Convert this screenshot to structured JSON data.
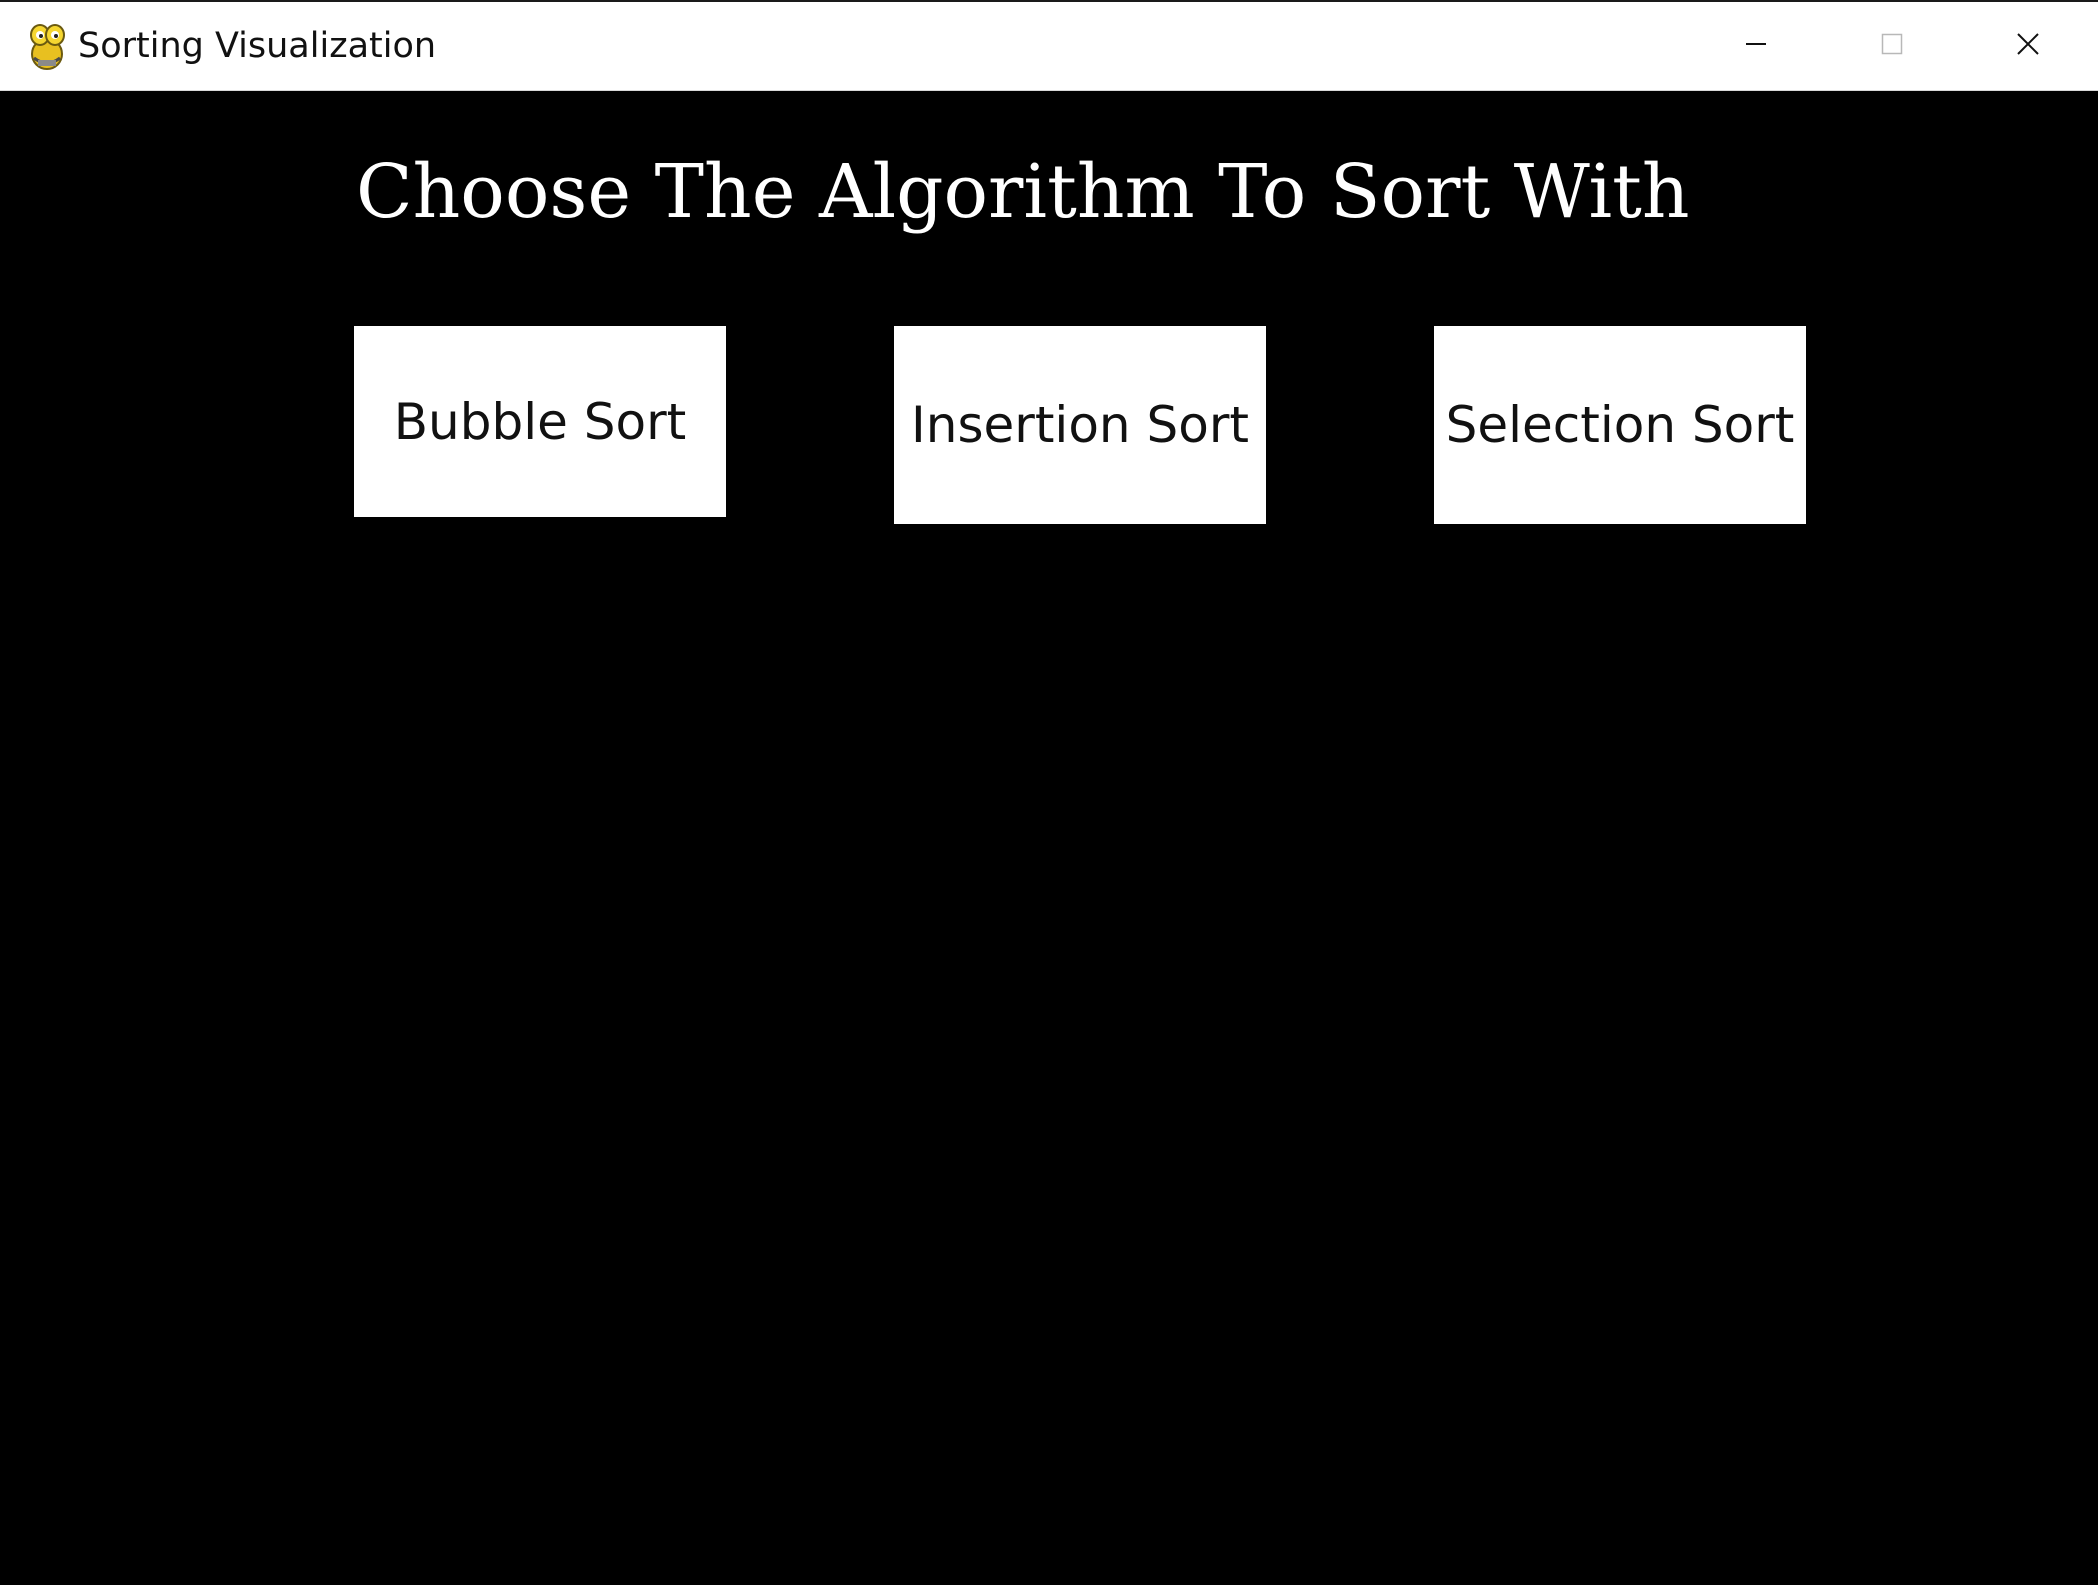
{
  "window": {
    "title": "Sorting Visualization",
    "icon": "pygame-snake-icon"
  },
  "controls": {
    "minimize_icon": "minimize-icon",
    "maximize_icon": "maximize-icon",
    "close_icon": "close-icon"
  },
  "main": {
    "heading": "Choose The Algorithm To Sort With",
    "buttons": [
      {
        "label": "Bubble Sort"
      },
      {
        "label": "Insertion Sort"
      },
      {
        "label": "Selection Sort"
      }
    ]
  },
  "colors": {
    "background": "#000000",
    "button": "#ffffff",
    "button_text": "#111111",
    "heading_text": "#ffffff"
  }
}
